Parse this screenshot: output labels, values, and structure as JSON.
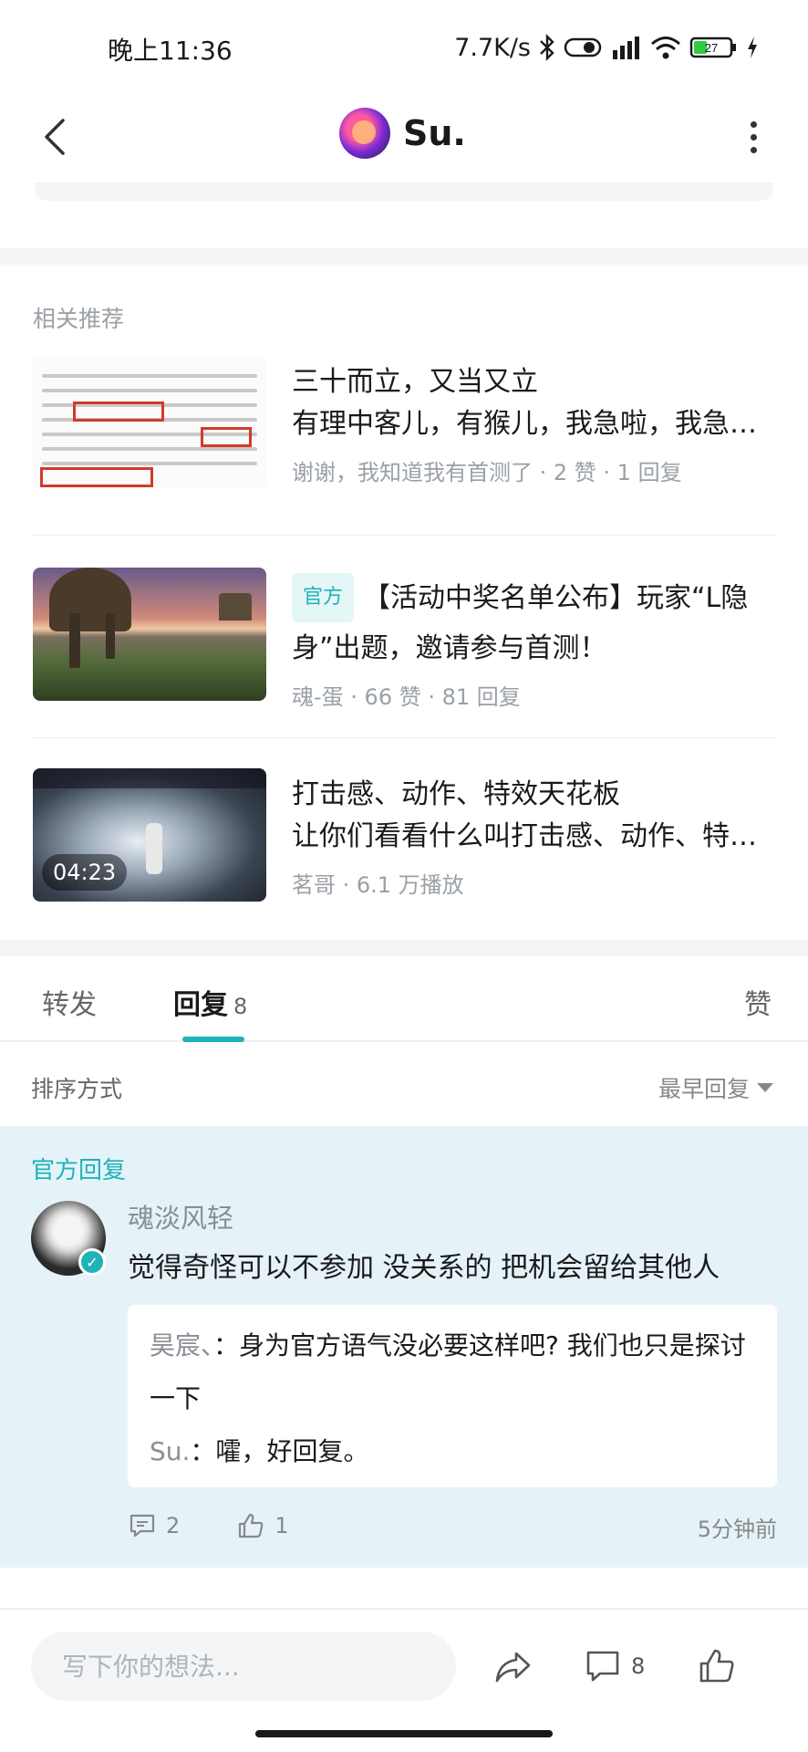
{
  "status_bar": {
    "time": "晚上11:36",
    "network_speed": "7.7K/s",
    "battery": "27"
  },
  "header": {
    "title": "Su."
  },
  "related": {
    "title": "相关推荐",
    "items": [
      {
        "line1": "三十而立，又当又立",
        "line2": "有理中客儿，有猴儿，我急啦，我急…",
        "meta": "谢谢，我知道我有首测了 · 2 赞 · 1 回复"
      },
      {
        "badge": "官方",
        "line1": "【活动中奖名单公布】玩家“L隐",
        "line2": "身”出题，邀请参与首测！",
        "meta": "魂-蛋 · 66 赞 · 81 回复"
      },
      {
        "line1": "打击感、动作、特效天花板",
        "line2": "让你们看看什么叫打击感、动作、特…",
        "meta": "茗哥 · 6.1 万播放",
        "video_duration": "04:23"
      }
    ]
  },
  "tabs": {
    "forward": "转发",
    "reply": "回复",
    "reply_count": "8",
    "like": "赞"
  },
  "sort": {
    "label": "排序方式",
    "value": "最早回复"
  },
  "official_reply": {
    "label": "官方回复",
    "author": "魂淡风轻",
    "text": "觉得奇怪可以不参加 没关系的 把机会留给其他人",
    "sub_replies": [
      {
        "name": "昊宸、",
        "text": "身为官方语气没必要这样吧? 我们也只是探讨一下"
      },
      {
        "name": "Su.",
        "text": "嚯，好回复。"
      }
    ],
    "comment_count": "2",
    "like_count": "1",
    "time": "5分钟前"
  },
  "bottom_bar": {
    "input_placeholder": "写下你的想法...",
    "comment_count": "8"
  },
  "colors": {
    "accent": "#1fb3b8",
    "official_bg": "#e5f3f9"
  }
}
